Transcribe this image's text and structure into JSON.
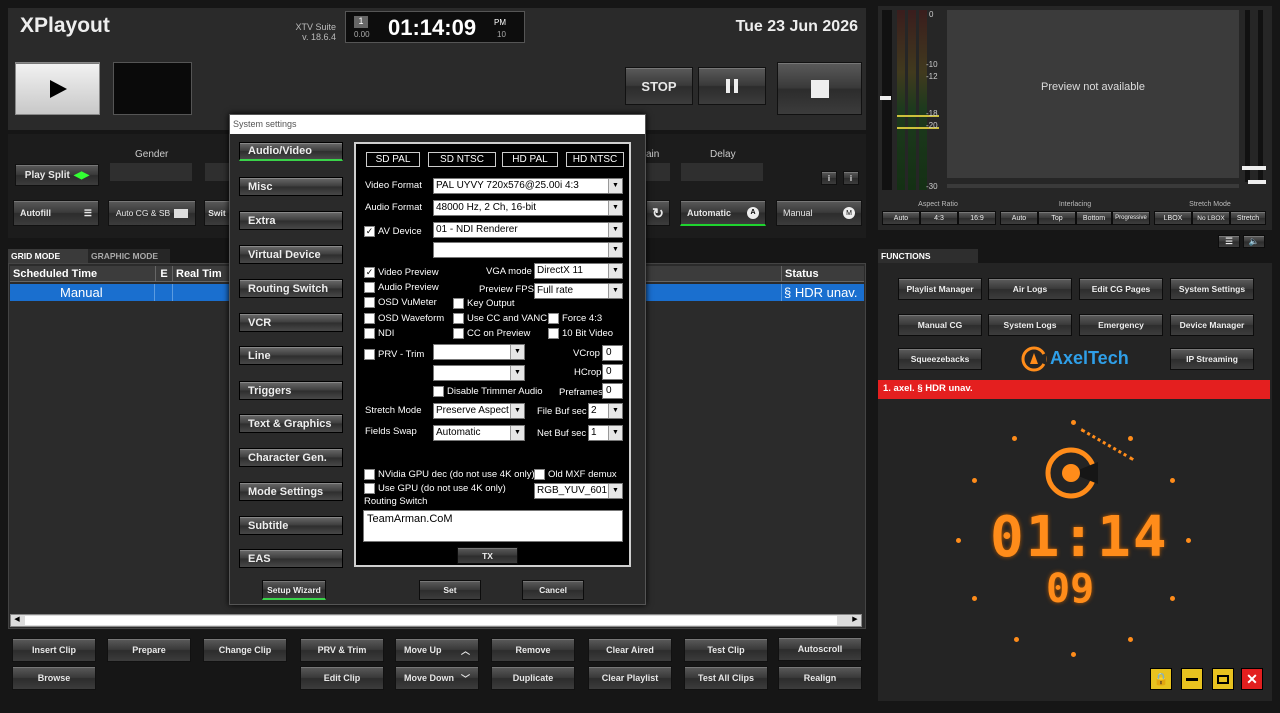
{
  "app": {
    "title": "XPlayout",
    "suite": "XTV Suite",
    "version": "v. 18.6.4",
    "date": "Tue 23 Jun 2026"
  },
  "timer": {
    "left_top": "1",
    "left_bottom": "0.00",
    "time": "01:14:09",
    "ampm": "PM",
    "right_bottom": "10"
  },
  "transport": {
    "stop": "STOP"
  },
  "labels": {
    "gender": "Gender",
    "main": "ain",
    "delay": "Delay"
  },
  "toolbar": {
    "play_split": "Play Split",
    "autofill": "Autofill",
    "auto_cg": "Auto CG & SB",
    "swit": "Swit",
    "automatic": "Automatic",
    "manual": "Manual"
  },
  "grid": {
    "tab_grid": "GRID MODE",
    "tab_graphic": "GRAPHIC MODE",
    "columns": [
      "Scheduled Time",
      "E",
      "Real Tim",
      "Status"
    ],
    "row": {
      "time": "Manual",
      "status": "§ HDR unav."
    }
  },
  "bottom_buttons": {
    "insert_clip": "Insert Clip",
    "prepare": "Prepare",
    "change_clip": "Change Clip",
    "prv_trim": "PRV & Trim",
    "move_up": "Move Up",
    "remove": "Remove",
    "clear_aired": "Clear Aired",
    "test_clip": "Test Clip",
    "autoscroll": "Autoscroll",
    "browse": "Browse",
    "edit_clip": "Edit Clip",
    "move_down": "Move Down",
    "duplicate": "Duplicate",
    "clear_playlist": "Clear Playlist",
    "test_all": "Test All Clips",
    "realign": "Realign"
  },
  "meter": {
    "marks": [
      "0",
      "-10",
      "-12",
      "-18",
      "-20",
      "-30"
    ]
  },
  "preview": {
    "text": "Preview not available",
    "aspect_title": "Aspect Ratio",
    "aspect": [
      "Auto",
      "4:3",
      "16:9"
    ],
    "interlace_title": "Interlacing",
    "interlace": [
      "Auto",
      "Top",
      "Bottom",
      "Progressive"
    ],
    "stretch_title": "Stretch Mode",
    "stretch": [
      "LBOX",
      "No LBOX",
      "Stretch"
    ]
  },
  "functions": {
    "title": "FUNCTIONS",
    "buttons": [
      "Playlist Manager",
      "Air Logs",
      "Edit CG Pages",
      "System Settings",
      "Manual CG",
      "System Logs",
      "Emergency",
      "Device Manager",
      "Squeezebacks",
      "IP Streaming"
    ],
    "logo": "AxelTech",
    "alert": "1. axel. § HDR unav."
  },
  "clock": {
    "hm": "01:14",
    "sec": "09"
  },
  "dialog": {
    "title": "System settings",
    "tabs": [
      "Audio/Video",
      "Misc",
      "Extra",
      "Virtual Device",
      "Routing Switch",
      "VCR",
      "Line",
      "Triggers",
      "Text & Graphics",
      "Character Gen.",
      "Mode Settings",
      "Subtitle",
      "EAS"
    ],
    "presets": [
      "SD PAL",
      "SD NTSC",
      "HD PAL",
      "HD NTSC"
    ],
    "video_format_label": "Video Format",
    "video_format": "PAL UYVY 720x576@25.00i 4:3",
    "audio_format_label": "Audio Format",
    "audio_format": "48000 Hz, 2 Ch, 16-bit",
    "av_device_label": "AV Device",
    "av_device": "01 - NDI Renderer",
    "video_preview": "Video Preview",
    "vga_mode_label": "VGA mode",
    "vga_mode": "DirectX 11",
    "audio_preview": "Audio Preview",
    "preview_fps_label": "Preview FPS",
    "preview_fps": "Full rate",
    "osd_vumeter": "OSD VuMeter",
    "key_output": "Key Output",
    "osd_waveform": "OSD Waveform",
    "use_cc": "Use CC and VANC",
    "force43": "Force 4:3",
    "ndi": "NDI",
    "cc_preview": "CC on Preview",
    "tenbit": "10 Bit Video",
    "prv_trim": "PRV - Trim",
    "vcrop_label": "VCrop",
    "vcrop": "0",
    "hcrop_label": "HCrop",
    "hcrop": "0",
    "disable_trimmer": "Disable Trimmer Audio",
    "preframes_label": "Preframes",
    "preframes": "0",
    "stretch_label": "Stretch Mode",
    "stretch": "Preserve Aspect",
    "filebuf_label": "File Buf sec",
    "filebuf": "2",
    "fields_label": "Fields Swap",
    "fields": "Automatic",
    "netbuf_label": "Net Buf sec",
    "netbuf": "1",
    "nvidia": "NVidia GPU dec (do not use 4K only)",
    "old_mxf": "Old MXF demux",
    "use_gpu": "Use GPU (do not use 4K only)",
    "rgb": "RGB_YUV_601",
    "routing_label": "Routing Switch",
    "routing_text": "TeamArman.CoM",
    "tx": "TX",
    "setup_wizard": "Setup Wizard",
    "set": "Set",
    "cancel": "Cancel"
  },
  "colors": {
    "accent": "#ff8c1a",
    "selection": "#1a6fcf",
    "alert": "#e41f1f"
  }
}
